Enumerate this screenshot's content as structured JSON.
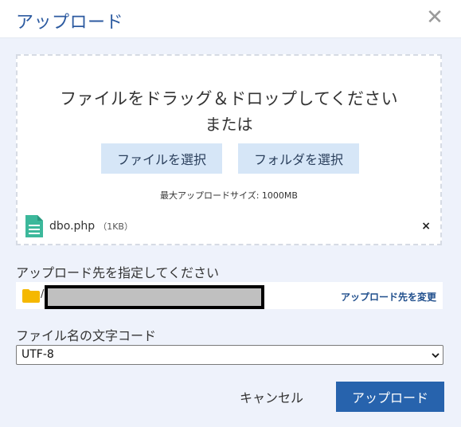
{
  "dialog": {
    "title": "アップロード",
    "close_icon": "close-icon"
  },
  "dropzone": {
    "main_text": "ファイルをドラッグ＆ドロップしてください",
    "or_text": "または",
    "select_file_label": "ファイルを選択",
    "select_folder_label": "フォルダを選択",
    "max_size_text": "最大アップロードサイズ: 1000MB"
  },
  "file": {
    "name": "dbo.php",
    "size": "（1KB）",
    "icon": "file-document-icon",
    "remove_icon": "remove-icon"
  },
  "destination": {
    "label": "アップロード先を指定してください",
    "path_prefix": "/",
    "change_label": "アップロード先を変更",
    "icon": "folder-icon"
  },
  "encoding": {
    "label": "ファイル名の文字コード",
    "selected": "UTF-8"
  },
  "actions": {
    "cancel_label": "キャンセル",
    "upload_label": "アップロード"
  },
  "colors": {
    "title": "#2c5aa0",
    "primary_button": "#2763ad",
    "light_button": "#d6e6f7",
    "file_icon": "#3cb89b",
    "folder_icon": "#f5b800"
  }
}
